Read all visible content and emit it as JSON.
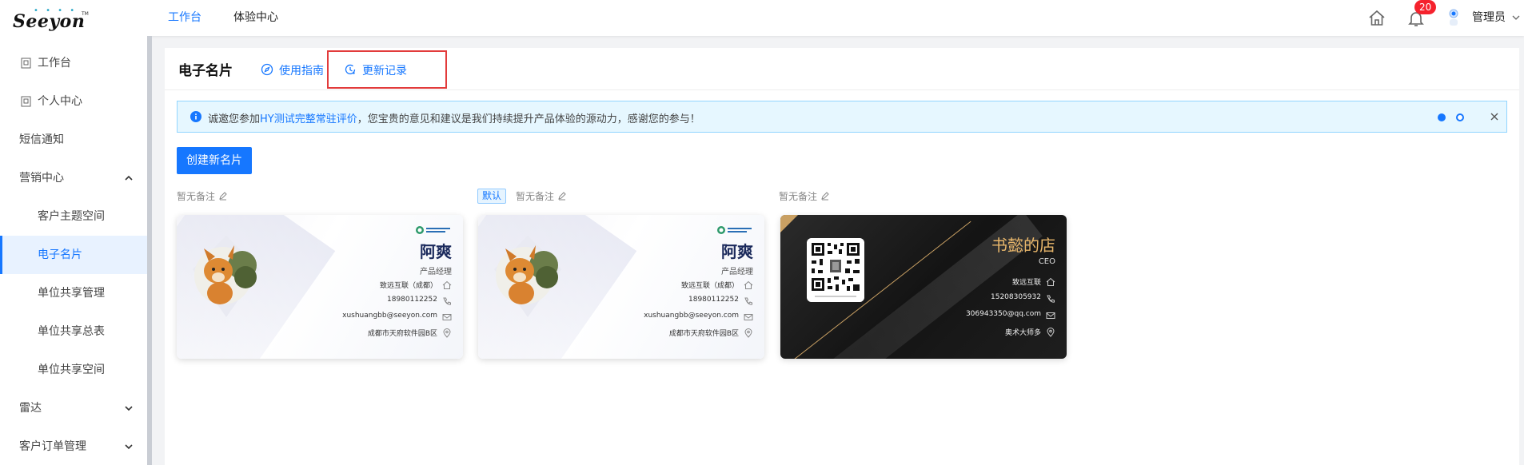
{
  "header": {
    "logo_text": "Seeyon",
    "logo_tm": "TM",
    "nav": [
      "工作台",
      "体验中心"
    ],
    "notification_count": "20",
    "user": "管理员"
  },
  "sidebar": {
    "items": [
      {
        "label": "工作台"
      },
      {
        "label": "个人中心"
      },
      {
        "label": "短信通知"
      },
      {
        "label": "营销中心"
      },
      {
        "label": "客户主题空间"
      },
      {
        "label": "电子名片"
      },
      {
        "label": "单位共享管理"
      },
      {
        "label": "单位共享总表"
      },
      {
        "label": "单位共享空间"
      },
      {
        "label": "雷达"
      },
      {
        "label": "客户订单管理"
      }
    ]
  },
  "page": {
    "title": "电子名片",
    "guide_link": "使用指南",
    "update_link": "更新记录"
  },
  "notice": {
    "prefix": "诚邀您参加",
    "link": "HY测试完整常驻评价",
    "suffix": "，您宝贵的意见和建议是我们持续提升产品体验的源动力，感谢您的参与！"
  },
  "create_button": "创建新名片",
  "cards": [
    {
      "remark": "暂无备注",
      "default_tag": "",
      "name": "阿爽",
      "role": "产品经理",
      "company": "致远互联（成都）",
      "phone": "18980112252",
      "email": "xushuangbb@seeyon.com",
      "address": "成都市天府软件园B区"
    },
    {
      "remark": "暂无备注",
      "default_tag": "默认",
      "name": "阿爽",
      "role": "产品经理",
      "company": "致远互联（成都）",
      "phone": "18980112252",
      "email": "xushuangbb@seeyon.com",
      "address": "成都市天府软件园B区"
    },
    {
      "remark": "暂无备注",
      "default_tag": "",
      "name": "书懿的店",
      "role": "CEO",
      "company": "致远互联",
      "phone": "15208305932",
      "email": "306943350@qq.com",
      "address": "奥术大师多"
    }
  ],
  "colors": {
    "accent": "#1677ff",
    "badge": "#f5222d",
    "highlight_box": "#e23b3b",
    "dark_card_gold": "#e9b76b"
  }
}
